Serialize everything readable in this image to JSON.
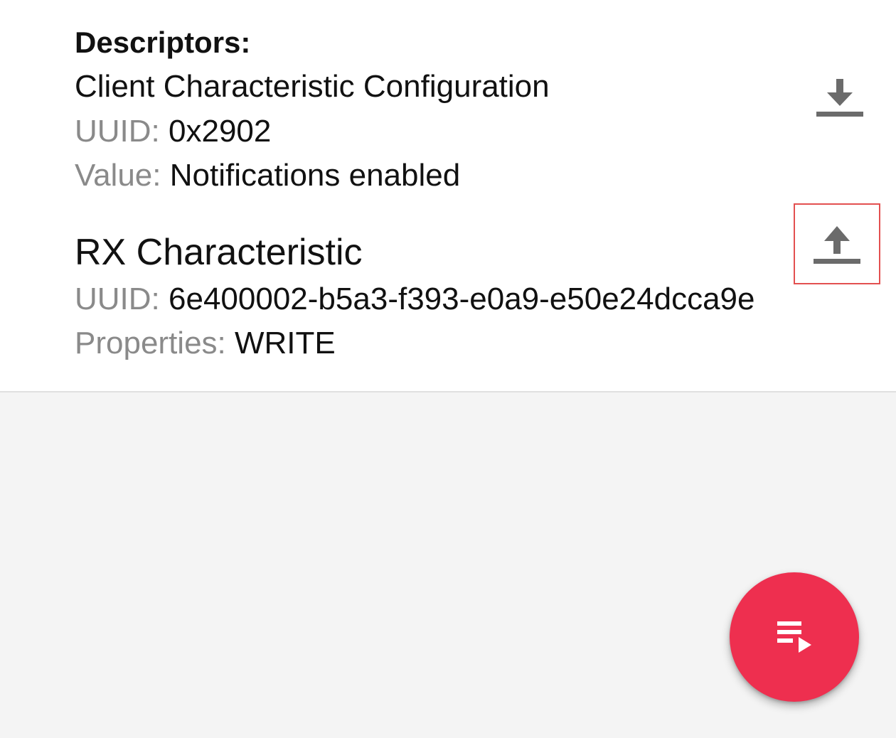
{
  "descriptors": {
    "heading": "Descriptors:",
    "name": "Client Characteristic Configuration",
    "uuid_label": "UUID:",
    "uuid_value": "0x2902",
    "value_label": "Value:",
    "value_value": "Notifications enabled",
    "action_icon": "download-icon"
  },
  "characteristic": {
    "name": "RX Characteristic",
    "uuid_label": "UUID:",
    "uuid_value": "6e400002-b5a3-f393-e0a9-e50e24dcca9e",
    "properties_label": "Properties:",
    "properties_value": "WRITE",
    "action_icon": "upload-icon"
  },
  "fab": {
    "icon": "playlist-play-icon",
    "color": "#ee2f4f"
  },
  "colors": {
    "label": "#8a8a8a",
    "text": "#111111",
    "icon": "#6b6b6b",
    "highlight": "#e35050",
    "background": "#f4f4f4"
  }
}
